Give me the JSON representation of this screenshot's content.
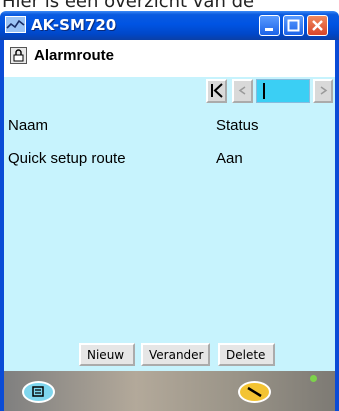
{
  "caption": {
    "text": "Hier is een overzicht van de"
  },
  "window": {
    "title": "AK-SM720"
  },
  "page": {
    "title": "Alarmroute"
  },
  "navigator": {
    "first_glyph": "K",
    "prev_glyph": "<",
    "next_glyph": ">",
    "field_value": ""
  },
  "table": {
    "columns": [
      "Naam",
      "Status"
    ],
    "rows": [
      {
        "name": "Quick setup route",
        "status": "Aan"
      }
    ]
  },
  "buttons": {
    "new": "Nieuw",
    "change": "Verander",
    "delete": "Delete"
  },
  "colors": {
    "content_bg": "#c7f3fd",
    "titlebar": "#0054e3",
    "nav_field": "#3bcff4"
  },
  "icons": [
    "app-icon",
    "lock-icon",
    "minimize-icon",
    "maximize-icon",
    "close-icon",
    "home-icon",
    "tool-icon",
    "status-led-icon"
  ]
}
